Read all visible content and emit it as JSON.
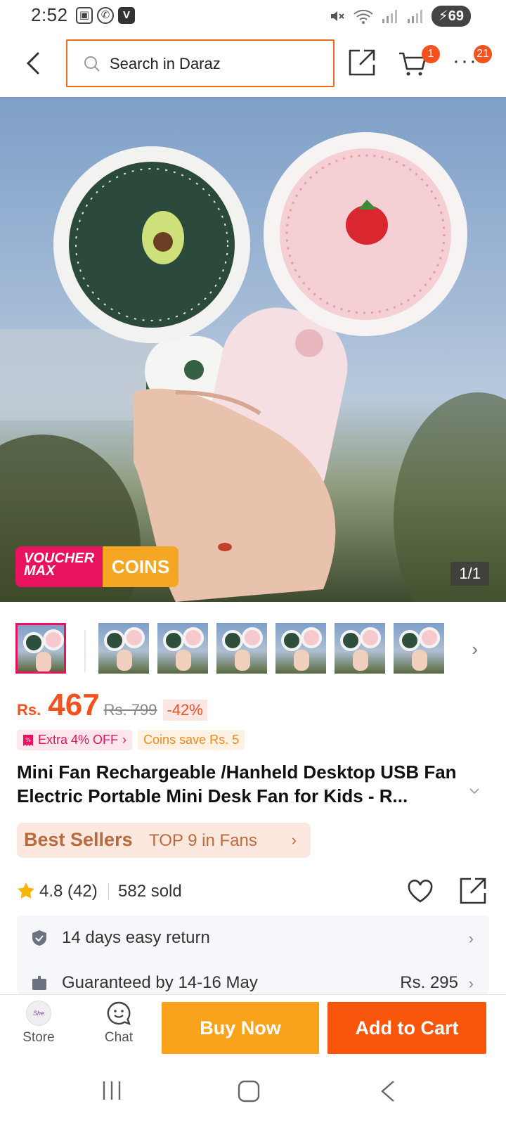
{
  "status_bar": {
    "time": "2:52",
    "battery": "69",
    "app_icons": [
      "gallery-icon",
      "whatsapp-icon",
      "v-icon"
    ],
    "v_label": "V"
  },
  "topbar": {
    "search_placeholder": "Search in Daraz",
    "cart_badge": "1",
    "more_badge": "21"
  },
  "gallery": {
    "counter": "1/1",
    "voucher_line1": "VOUCHER",
    "voucher_line2": "MAX",
    "coins_label": "COINS",
    "thumbnail_count": 7
  },
  "price": {
    "currency": "Rs.",
    "current": "467",
    "original": "Rs. 799",
    "discount": "-42%"
  },
  "promos": {
    "extra_off": "Extra 4% OFF",
    "coins_save": "Coins save Rs. 5"
  },
  "product": {
    "title": "Mini Fan Rechargeable /Hanheld Desktop USB Fan Electric Portable Mini Desk Fan for Kids - R..."
  },
  "best_sellers": {
    "label": "Best Sellers",
    "rank": "TOP 9 in Fans"
  },
  "rating": {
    "score": "4.8 (42)",
    "sold": "582 sold"
  },
  "info": {
    "return_policy": "14 days easy return",
    "delivery": "Guaranteed by 14-16 May",
    "delivery_price": "Rs. 295"
  },
  "actions": {
    "store_label": "Store",
    "store_logo_text": "She",
    "chat_label": "Chat",
    "buy_now": "Buy Now",
    "add_to_cart": "Add to Cart"
  },
  "colors": {
    "brand_orange": "#f8560d",
    "buy_now": "#f9a21c",
    "voucher_pink": "#e8125f"
  }
}
